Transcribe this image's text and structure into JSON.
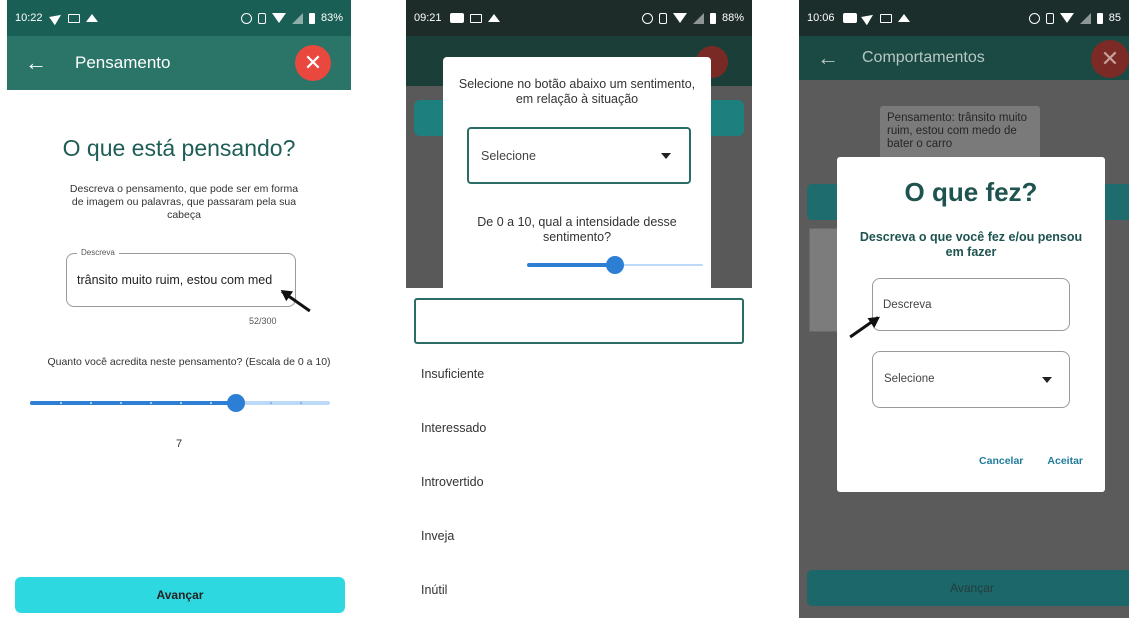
{
  "screen1": {
    "status": {
      "time": "10:22",
      "battery": "83%"
    },
    "appbar": {
      "title": "Pensamento",
      "back_icon": "arrow-left-icon",
      "close_icon": "close-icon",
      "close_color": "#e8483e"
    },
    "heading": "O que está pensando?",
    "description": "Descreva o pensamento, que pode ser em forma de imagem ou palavras, que passaram pela sua cabeça",
    "field": {
      "label": "Descreva",
      "value": "trânsito muito ruim, estou com med",
      "counter": "52/300"
    },
    "question": "Quanto você acredita neste pensamento? (Escala de 0 a 10)",
    "slider": {
      "value": "7",
      "min": 0,
      "max": 10,
      "level": 7,
      "active_color": "#2d7fd6",
      "inactive_color": "#bcdaf8"
    },
    "button": "Avançar",
    "button_color": "#2ed8e0"
  },
  "screen2": {
    "status": {
      "time": "09:21",
      "battery": "88%"
    },
    "dialog": {
      "prompt": "Selecione no botão abaixo um sentimento, em relação à situação",
      "select": "Selecione",
      "question": "De 0 a 10, qual a intensidade desse sentimento?",
      "slider_level": 0.5
    },
    "search_value": "",
    "options": [
      "Insuficiente",
      "Interessado",
      "Introvertido",
      "Inveja",
      "Inútil"
    ]
  },
  "screen3": {
    "status": {
      "time": "10:06",
      "battery": "85"
    },
    "appbar": {
      "title": "Comportamentos",
      "back_icon": "arrow-left-icon",
      "close_icon": "close-icon"
    },
    "card_text": "Pensamento: trânsito muito ruim, estou com medo de bater o carro",
    "dialog": {
      "title": "O que fez?",
      "subtitle": "Descreva o que você fez e/ou pensou em fazer",
      "field_placeholder": "Descreva",
      "select": "Selecione",
      "cancel": "Cancelar",
      "accept": "Aceitar",
      "accent_color": "#1f7c9a"
    },
    "footer_button": "Avançar"
  }
}
